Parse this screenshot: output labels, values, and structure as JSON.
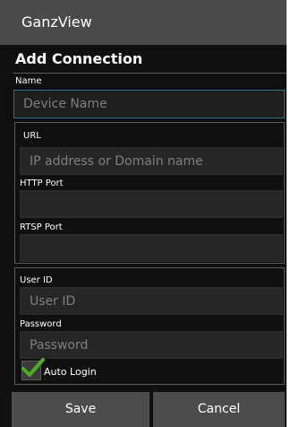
{
  "app": {
    "title": "GanzView"
  },
  "dialog": {
    "title": "Add Connection"
  },
  "fields": {
    "name_label": "Name",
    "name_placeholder": "Device Name",
    "url_label": "URL",
    "url_placeholder": "IP address or Domain name",
    "http_port_label": "HTTP Port",
    "http_port_value": "",
    "rtsp_port_label": "RTSP Port",
    "rtsp_port_value": "",
    "user_id_label": "User ID",
    "user_id_placeholder": "User ID",
    "password_label": "Password",
    "password_placeholder": "Password",
    "auto_login_label": "Auto Login",
    "auto_login_checked": true
  },
  "buttons": {
    "save": "Save",
    "cancel": "Cancel"
  },
  "colors": {
    "titlebar": "#4a4a4a",
    "focus_border": "#2f6e8e",
    "check_green": "#4caf1f"
  },
  "icons": {
    "checkmark": "check-icon"
  }
}
